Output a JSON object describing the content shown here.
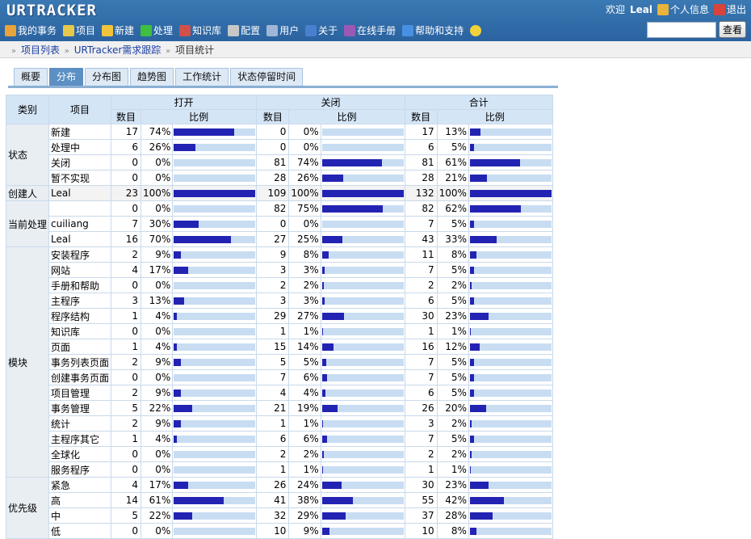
{
  "app": {
    "logo": "URTRACKER"
  },
  "user": {
    "welcome": "欢迎",
    "name": "Leal",
    "profile": "个人信息",
    "logout": "退出"
  },
  "menu": [
    {
      "label": "我的事务",
      "icon": "home-icon",
      "color": "#e8a33a"
    },
    {
      "label": "项目",
      "icon": "database-icon",
      "color": "#e6c84a"
    },
    {
      "label": "新建",
      "icon": "new-card-icon",
      "color": "#f2c43b"
    },
    {
      "label": "处理",
      "icon": "check-icon",
      "color": "#3fbf3f"
    },
    {
      "label": "知识库",
      "icon": "books-icon",
      "color": "#d0504a"
    },
    {
      "label": "配置",
      "icon": "gear-icon",
      "color": "#c7c7c7"
    },
    {
      "label": "用户",
      "icon": "users-icon",
      "color": "#9fb6d6"
    },
    {
      "label": "关于",
      "icon": "info-icon",
      "color": "#4a7fd0"
    },
    {
      "label": "在线手册",
      "icon": "manual-book-icon",
      "color": "#9b59b6"
    },
    {
      "label": "帮助和支持",
      "icon": "help-icon",
      "color": "#4a90e2"
    }
  ],
  "search": {
    "value": "",
    "button": "查看"
  },
  "breadcrumb": {
    "items": [
      "项目列表",
      "URTracker需求跟踪",
      "项目统计"
    ]
  },
  "tabs": [
    {
      "label": "概要",
      "active": false
    },
    {
      "label": "分布",
      "active": true
    },
    {
      "label": "分布图",
      "active": false
    },
    {
      "label": "趋势图",
      "active": false
    },
    {
      "label": "工作统计",
      "active": false
    },
    {
      "label": "状态停留时间",
      "active": false
    }
  ],
  "table": {
    "headers": {
      "category": "类别",
      "item": "项目",
      "open": "打开",
      "closed": "关闭",
      "total": "合计",
      "count": "数目",
      "ratio": "比例"
    },
    "groups": [
      {
        "category": "状态",
        "rows": [
          {
            "item": "新建",
            "open": [
              17,
              "74%"
            ],
            "closed": [
              0,
              "0%"
            ],
            "total": [
              17,
              "13%"
            ]
          },
          {
            "item": "处理中",
            "open": [
              6,
              "26%"
            ],
            "closed": [
              0,
              "0%"
            ],
            "total": [
              6,
              "5%"
            ]
          },
          {
            "item": "关闭",
            "open": [
              0,
              "0%"
            ],
            "closed": [
              81,
              "74%"
            ],
            "total": [
              81,
              "61%"
            ]
          },
          {
            "item": "暂不实现",
            "open": [
              0,
              "0%"
            ],
            "closed": [
              28,
              "26%"
            ],
            "total": [
              28,
              "21%"
            ]
          }
        ]
      },
      {
        "category": "创建人",
        "rows": [
          {
            "item": "Leal",
            "open": [
              23,
              "100%"
            ],
            "closed": [
              109,
              "100%"
            ],
            "total": [
              132,
              "100%"
            ]
          }
        ]
      },
      {
        "category": "当前处理",
        "rows": [
          {
            "item": "",
            "open": [
              0,
              "0%"
            ],
            "closed": [
              82,
              "75%"
            ],
            "total": [
              82,
              "62%"
            ]
          },
          {
            "item": "cuiliang",
            "open": [
              7,
              "30%"
            ],
            "closed": [
              0,
              "0%"
            ],
            "total": [
              7,
              "5%"
            ]
          },
          {
            "item": "Leal",
            "open": [
              16,
              "70%"
            ],
            "closed": [
              27,
              "25%"
            ],
            "total": [
              43,
              "33%"
            ]
          }
        ]
      },
      {
        "category": "模块",
        "rows": [
          {
            "item": "安装程序",
            "open": [
              2,
              "9%"
            ],
            "closed": [
              9,
              "8%"
            ],
            "total": [
              11,
              "8%"
            ]
          },
          {
            "item": "网站",
            "open": [
              4,
              "17%"
            ],
            "closed": [
              3,
              "3%"
            ],
            "total": [
              7,
              "5%"
            ]
          },
          {
            "item": "手册和帮助",
            "open": [
              0,
              "0%"
            ],
            "closed": [
              2,
              "2%"
            ],
            "total": [
              2,
              "2%"
            ]
          },
          {
            "item": "主程序",
            "open": [
              3,
              "13%"
            ],
            "closed": [
              3,
              "3%"
            ],
            "total": [
              6,
              "5%"
            ]
          },
          {
            "item": "程序结构",
            "open": [
              1,
              "4%"
            ],
            "closed": [
              29,
              "27%"
            ],
            "total": [
              30,
              "23%"
            ]
          },
          {
            "item": "知识库",
            "open": [
              0,
              "0%"
            ],
            "closed": [
              1,
              "1%"
            ],
            "total": [
              1,
              "1%"
            ]
          },
          {
            "item": "页面",
            "open": [
              1,
              "4%"
            ],
            "closed": [
              15,
              "14%"
            ],
            "total": [
              16,
              "12%"
            ]
          },
          {
            "item": "事务列表页面",
            "open": [
              2,
              "9%"
            ],
            "closed": [
              5,
              "5%"
            ],
            "total": [
              7,
              "5%"
            ]
          },
          {
            "item": "创建事务页面",
            "open": [
              0,
              "0%"
            ],
            "closed": [
              7,
              "6%"
            ],
            "total": [
              7,
              "5%"
            ]
          },
          {
            "item": "项目管理",
            "open": [
              2,
              "9%"
            ],
            "closed": [
              4,
              "4%"
            ],
            "total": [
              6,
              "5%"
            ]
          },
          {
            "item": "事务管理",
            "open": [
              5,
              "22%"
            ],
            "closed": [
              21,
              "19%"
            ],
            "total": [
              26,
              "20%"
            ]
          },
          {
            "item": "统计",
            "open": [
              2,
              "9%"
            ],
            "closed": [
              1,
              "1%"
            ],
            "total": [
              3,
              "2%"
            ]
          },
          {
            "item": "主程序其它",
            "open": [
              1,
              "4%"
            ],
            "closed": [
              6,
              "6%"
            ],
            "total": [
              7,
              "5%"
            ]
          },
          {
            "item": "全球化",
            "open": [
              0,
              "0%"
            ],
            "closed": [
              2,
              "2%"
            ],
            "total": [
              2,
              "2%"
            ]
          },
          {
            "item": "服务程序",
            "open": [
              0,
              "0%"
            ],
            "closed": [
              1,
              "1%"
            ],
            "total": [
              1,
              "1%"
            ]
          }
        ]
      },
      {
        "category": "优先级",
        "rows": [
          {
            "item": "紧急",
            "open": [
              4,
              "17%"
            ],
            "closed": [
              26,
              "24%"
            ],
            "total": [
              30,
              "23%"
            ]
          },
          {
            "item": "高",
            "open": [
              14,
              "61%"
            ],
            "closed": [
              41,
              "38%"
            ],
            "total": [
              55,
              "42%"
            ]
          },
          {
            "item": "中",
            "open": [
              5,
              "22%"
            ],
            "closed": [
              32,
              "29%"
            ],
            "total": [
              37,
              "28%"
            ]
          },
          {
            "item": "低",
            "open": [
              0,
              "0%"
            ],
            "closed": [
              10,
              "9%"
            ],
            "total": [
              10,
              "8%"
            ]
          }
        ]
      }
    ]
  },
  "colors": {
    "header": "#3a79b3",
    "bar": "#2323b3",
    "bar_track": "#c8ddf2",
    "tab_active": "#5c8fc3"
  }
}
